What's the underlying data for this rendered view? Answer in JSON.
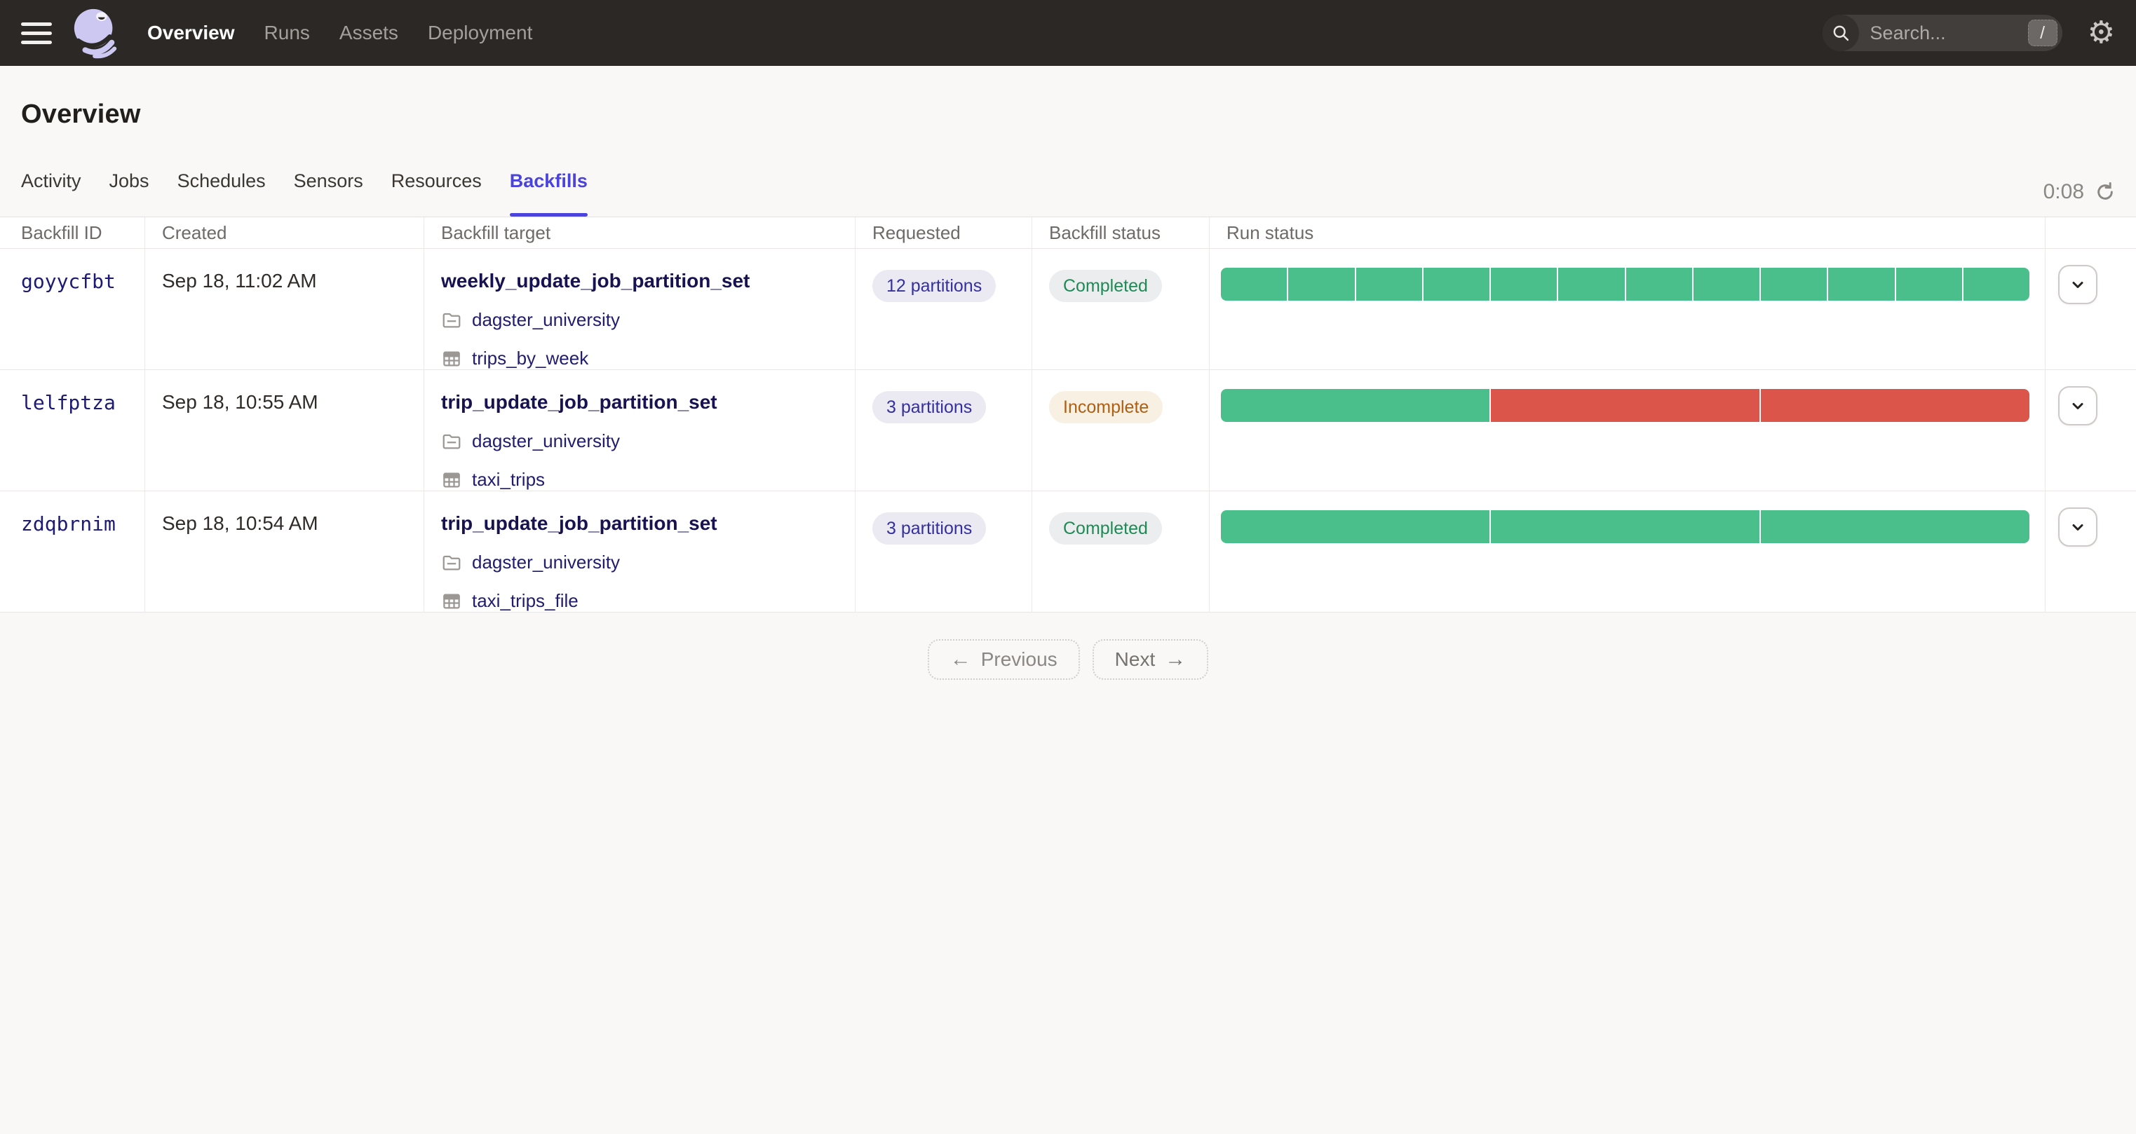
{
  "topbar": {
    "nav": [
      {
        "label": "Overview",
        "active": true
      },
      {
        "label": "Runs",
        "active": false
      },
      {
        "label": "Assets",
        "active": false
      },
      {
        "label": "Deployment",
        "active": false
      }
    ],
    "search": {
      "placeholder": "Search...",
      "shortcut": "/"
    }
  },
  "page": {
    "title": "Overview"
  },
  "tabs": {
    "items": [
      {
        "label": "Activity",
        "active": false
      },
      {
        "label": "Jobs",
        "active": false
      },
      {
        "label": "Schedules",
        "active": false
      },
      {
        "label": "Sensors",
        "active": false
      },
      {
        "label": "Resources",
        "active": false
      },
      {
        "label": "Backfills",
        "active": true
      }
    ],
    "refresh_countdown": "0:08"
  },
  "table": {
    "columns": [
      "Backfill ID",
      "Created",
      "Backfill target",
      "Requested",
      "Backfill status",
      "Run status"
    ],
    "rows": [
      {
        "id": "goyycfbt",
        "created": "Sep 18, 11:02 AM",
        "target": "weekly_update_job_partition_set",
        "code_location": "dagster_university",
        "partition_set": "trips_by_week",
        "requested": "12 partitions",
        "status_label": "Completed",
        "status_type": "completed",
        "run_segments": [
          "success",
          "success",
          "success",
          "success",
          "success",
          "success",
          "success",
          "success",
          "success",
          "success",
          "success",
          "success"
        ]
      },
      {
        "id": "lelfptza",
        "created": "Sep 18, 10:55 AM",
        "target": "trip_update_job_partition_set",
        "code_location": "dagster_university",
        "partition_set": "taxi_trips",
        "requested": "3 partitions",
        "status_label": "Incomplete",
        "status_type": "incomplete",
        "run_segments": [
          "success",
          "failure",
          "failure"
        ]
      },
      {
        "id": "zdqbrnim",
        "created": "Sep 18, 10:54 AM",
        "target": "trip_update_job_partition_set",
        "code_location": "dagster_university",
        "partition_set": "taxi_trips_file",
        "requested": "3 partitions",
        "status_label": "Completed",
        "status_type": "completed",
        "run_segments": [
          "success",
          "success",
          "success"
        ]
      }
    ]
  },
  "pagination": {
    "previous_label": "Previous",
    "next_label": "Next"
  },
  "icons": {
    "gear": "⚙",
    "prev_arrow": "←",
    "next_arrow": "→"
  },
  "colors": {
    "topbar_bg": "#2C2825",
    "page_bg": "#FAF8F6",
    "accent": "#4A43DC",
    "link_navy": "#1D1A73",
    "requested_text": "#34309F",
    "completed_text": "#1F8A55",
    "incomplete_text": "#AF5F13",
    "run_status": {
      "success": "#4BBF8B",
      "failure": "#DC554B"
    }
  }
}
